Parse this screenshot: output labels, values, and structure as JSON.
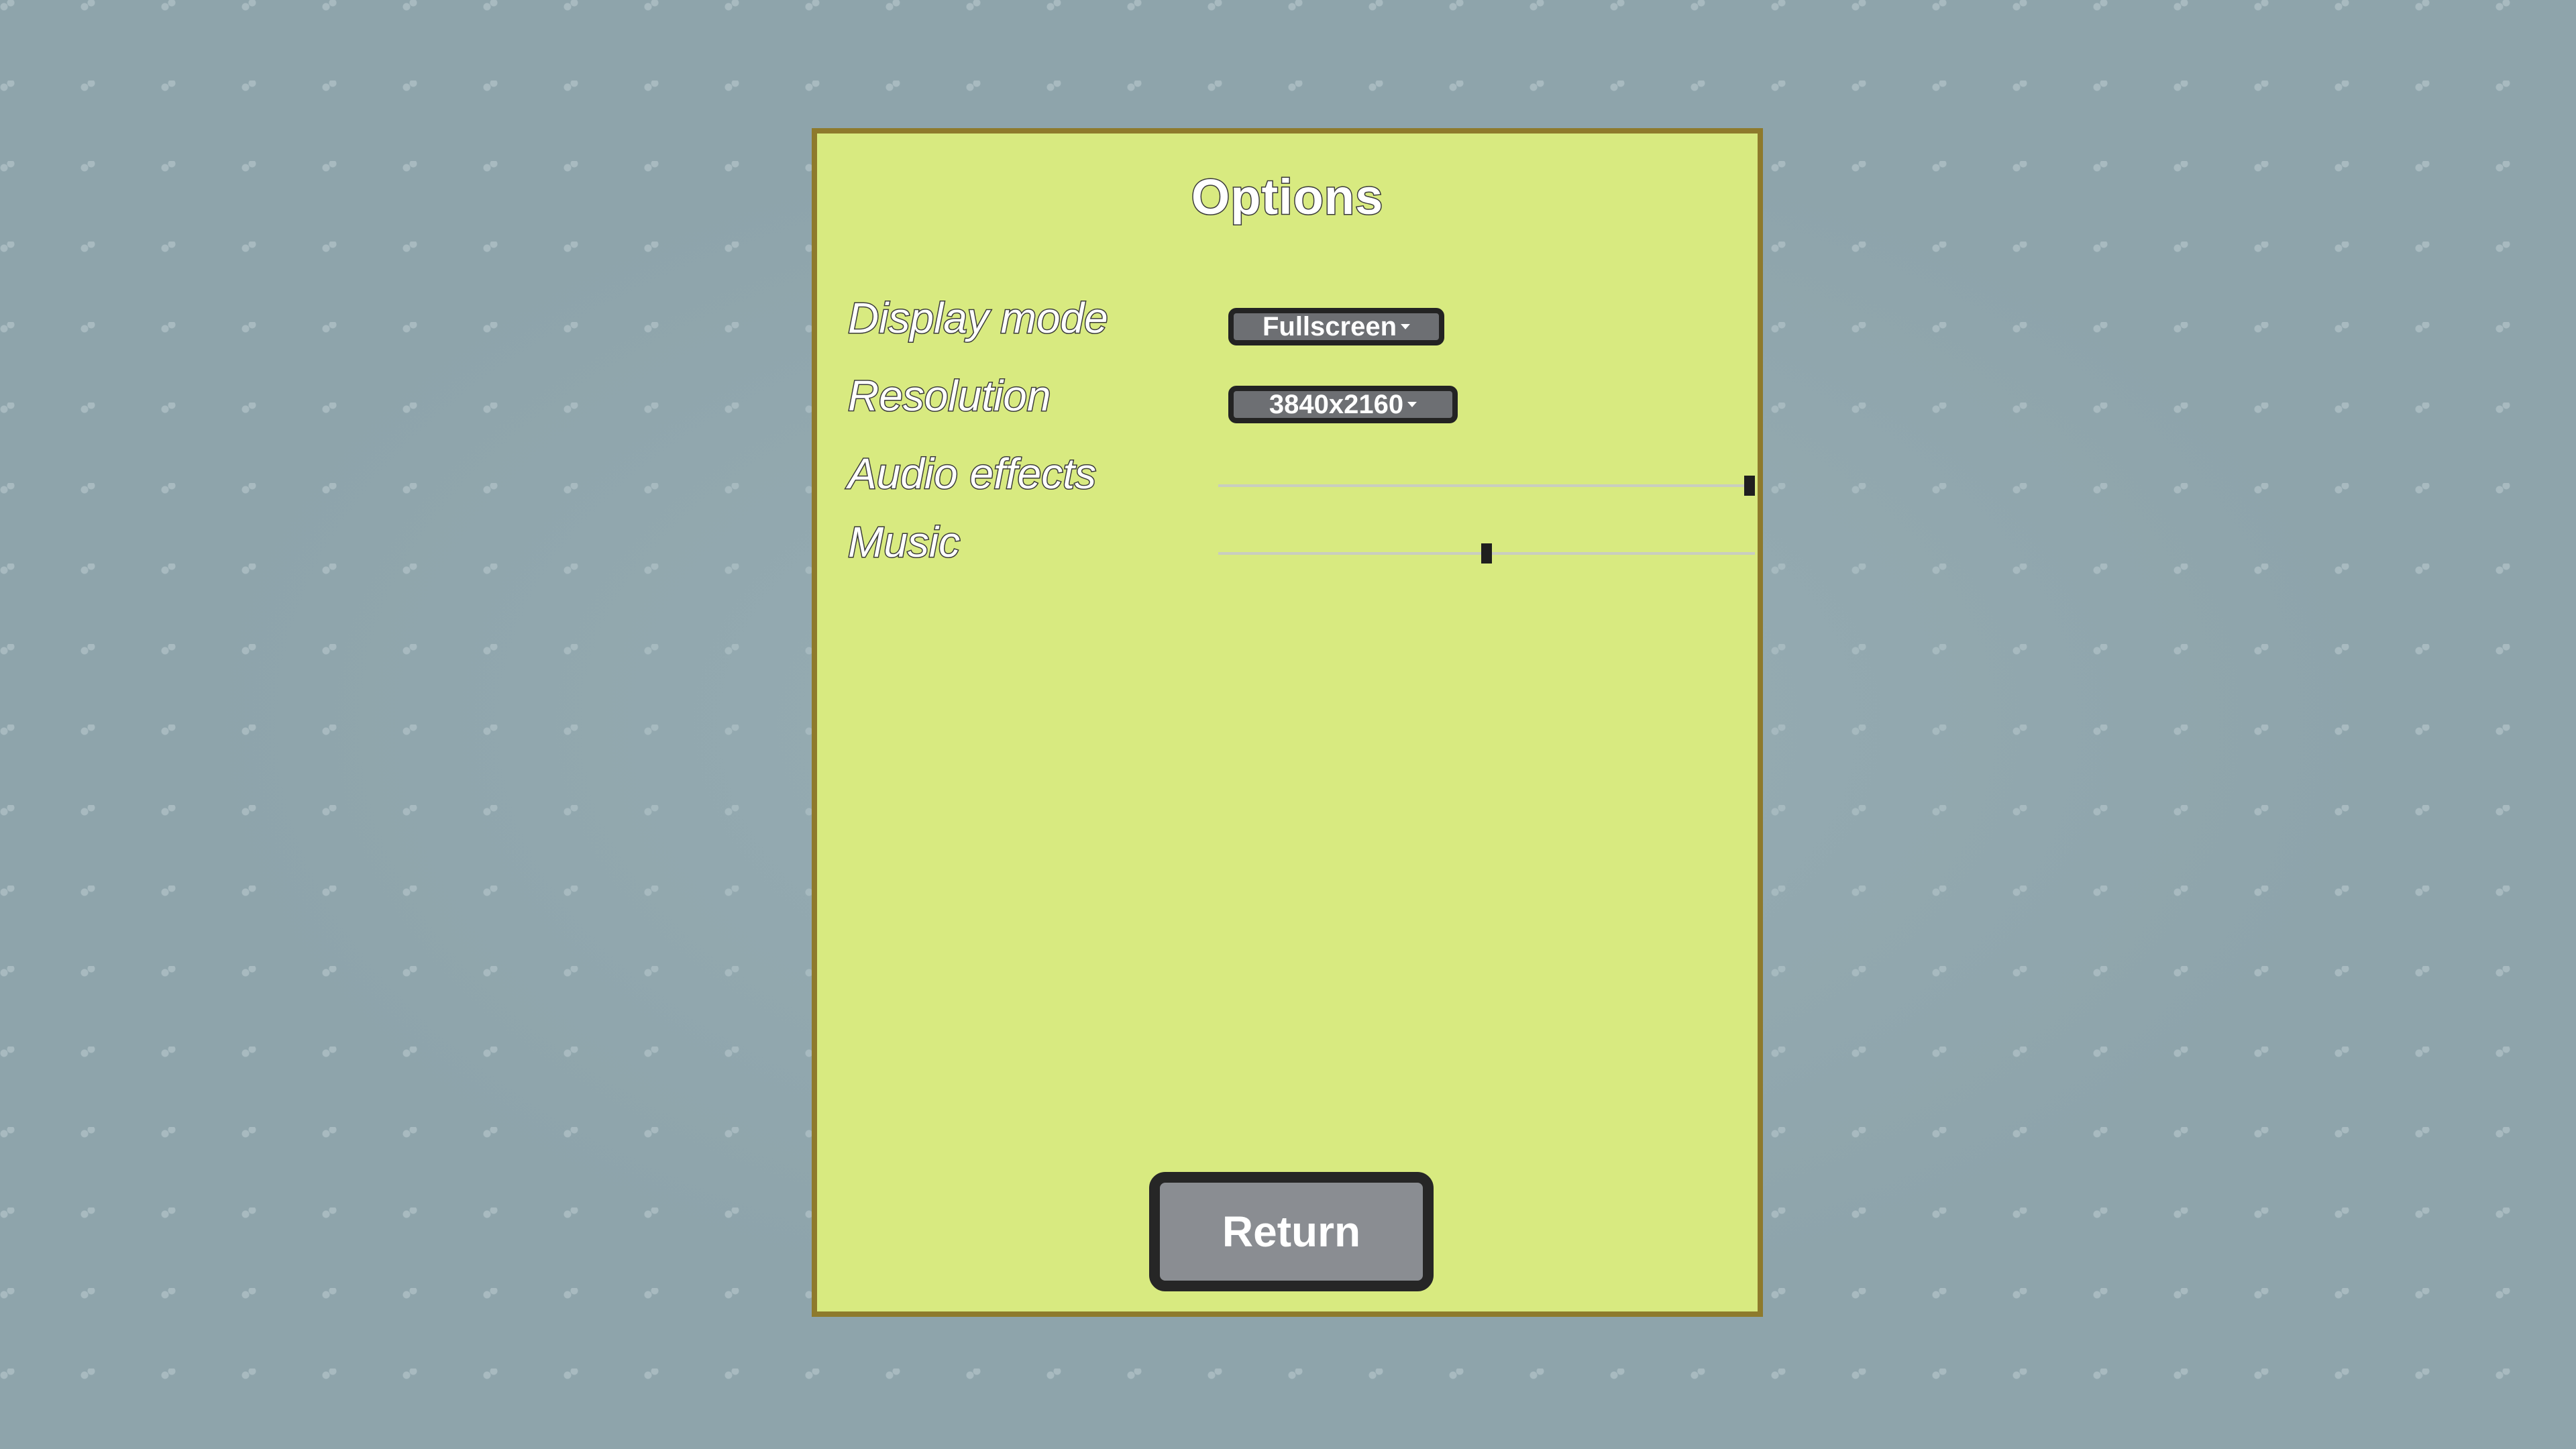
{
  "options": {
    "title": "Options",
    "display_mode": {
      "label": "Display mode",
      "value": "Fullscreen"
    },
    "resolution": {
      "label": "Resolution",
      "value": "3840x2160"
    },
    "audio_effects": {
      "label": "Audio effects",
      "level": 1.0
    },
    "music": {
      "label": "Music",
      "level": 0.5
    },
    "return_label": "Return"
  },
  "colors": {
    "background": "#8ea4ab",
    "panel": "#d8ea80",
    "panel_border": "#8e7a2c",
    "button": "#8a8d92",
    "button_border": "#262626",
    "dropdown": "#6d6f73"
  },
  "icons": {
    "dropdown_caret": "chevron-down-icon"
  }
}
